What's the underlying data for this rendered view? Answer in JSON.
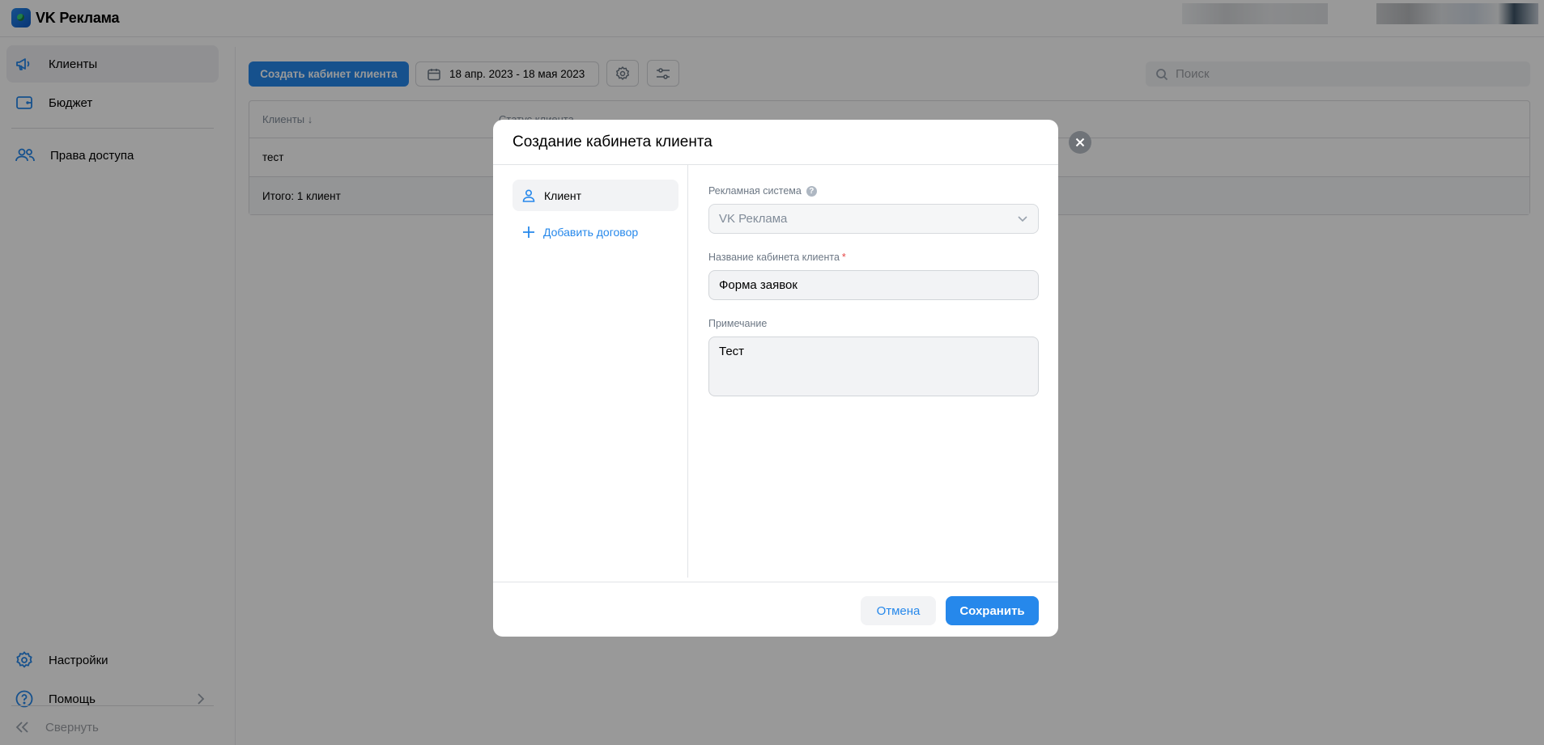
{
  "app": {
    "title": "VK Реклама"
  },
  "sidebar": {
    "items": [
      {
        "label": "Клиенты",
        "icon": "megaphone-icon"
      },
      {
        "label": "Бюджет",
        "icon": "wallet-icon"
      },
      {
        "label": "Права доступа",
        "icon": "users-icon"
      }
    ],
    "bottom": {
      "settings": "Настройки",
      "help": "Помощь",
      "collapse": "Свернуть"
    }
  },
  "toolbar": {
    "create_label": "Создать кабинет клиента",
    "date_range": "18 апр. 2023 - 18 мая 2023",
    "search_placeholder": "Поиск"
  },
  "table": {
    "columns": [
      "Клиенты ↓",
      "Статус клиента"
    ],
    "rows": [
      {
        "name": "тест"
      }
    ],
    "footer": "Итого: 1 клиент"
  },
  "modal": {
    "title": "Создание кабинета клиента",
    "tabs": {
      "client": "Клиент",
      "add_contract": "Добавить договор"
    },
    "fields": {
      "ad_system_label": "Рекламная система",
      "ad_system_value": "VK Реклама",
      "cabinet_name_label": "Название кабинета клиента",
      "cabinet_name_value": "Форма заявок",
      "note_label": "Примечание",
      "note_value": "Тест"
    },
    "buttons": {
      "cancel": "Отмена",
      "save": "Сохранить"
    }
  },
  "colors": {
    "accent": "#2688eb",
    "overlay": "rgba(0,0,0,0.40)",
    "required": "#e64646"
  }
}
